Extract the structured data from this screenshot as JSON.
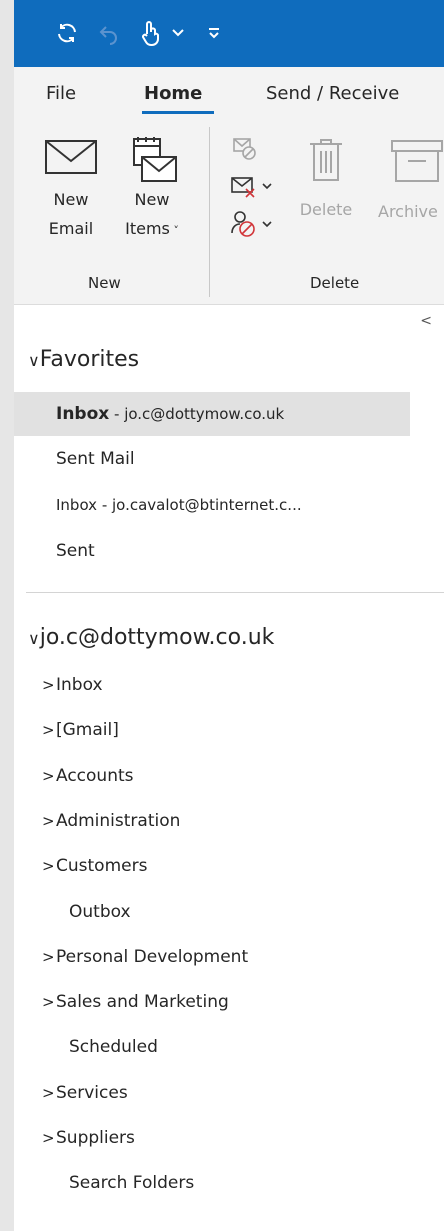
{
  "ribbon": {
    "tabs": [
      "File",
      "Home",
      "Send / Receive"
    ],
    "new_email_line1": "New",
    "new_email_line2": "Email",
    "new_items_line1": "New",
    "new_items_line2": "Items",
    "new_group": "New",
    "delete_label": "Delete",
    "archive_label": "Archive",
    "delete_group": "Delete"
  },
  "favorites": {
    "header": "Favorites",
    "items": [
      {
        "bold": "Inbox",
        "rest": " - jo.c@dottymow.co.uk"
      },
      {
        "bold": "",
        "rest": "Sent Mail"
      },
      {
        "bold": "",
        "rest": "Inbox - jo.cavalot@btinternet.c..."
      },
      {
        "bold": "",
        "rest": "Sent"
      }
    ]
  },
  "account": {
    "header": "jo.c@dottymow.co.uk",
    "folders": [
      {
        "label": "Inbox",
        "expandable": true
      },
      {
        "label": "[Gmail]",
        "expandable": true
      },
      {
        "label": "Accounts",
        "expandable": true
      },
      {
        "label": "Administration",
        "expandable": true
      },
      {
        "label": "Customers",
        "expandable": true
      },
      {
        "label": "Outbox",
        "expandable": false
      },
      {
        "label": "Personal Development",
        "expandable": true
      },
      {
        "label": "Sales and Marketing",
        "expandable": true
      },
      {
        "label": "Scheduled",
        "expandable": false
      },
      {
        "label": "Services",
        "expandable": true
      },
      {
        "label": "Suppliers",
        "expandable": true
      },
      {
        "label": "Search Folders",
        "expandable": false
      }
    ]
  },
  "colors": {
    "accent": "#0f6cbd",
    "selected": "#e1e1e1"
  }
}
